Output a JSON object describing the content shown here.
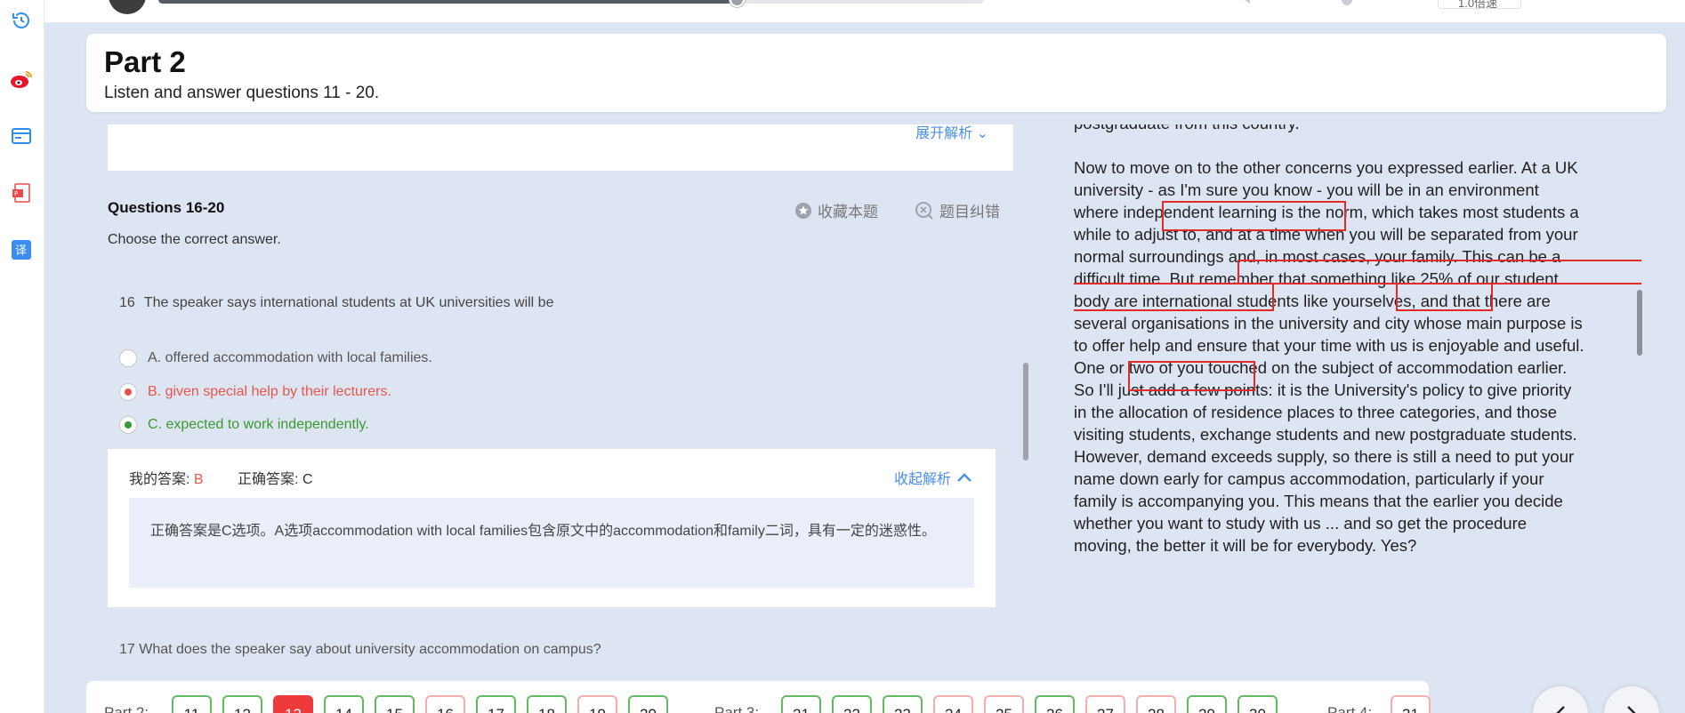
{
  "header": {
    "part_title": "Part 2",
    "instruction": "Listen and answer questions 11 - 20."
  },
  "audio": {
    "progress_fraction": 0.7,
    "speed_label": "1.0倍速"
  },
  "previous_question": {
    "expand_label": "展开解析"
  },
  "question_group": {
    "heading": "Questions 16-20",
    "instruction": "Choose the correct answer.",
    "favorite_label": "收藏本题",
    "report_label": "题目纠错"
  },
  "question": {
    "number": "16",
    "text": "The speaker says international students at UK universities will be",
    "options": [
      {
        "text": "A. offered accommodation with local families.",
        "state": "none",
        "color": "#555555"
      },
      {
        "text": "B. given special help by their lecturers.",
        "state": "wrong",
        "color": "#e8564b"
      },
      {
        "text": "C. expected to work independently.",
        "state": "correct",
        "color": "#3a9a2e"
      }
    ]
  },
  "analysis": {
    "my_answer_label": "我的答案:",
    "my_answer": "B",
    "correct_answer_label": "正确答案:",
    "correct_answer": "C",
    "collapse_label": "收起解析",
    "explanation": "正确答案是C选项。A选项accommodation with local families包含原文中的accommodation和family二词，具有一定的迷惑性。"
  },
  "next_question": {
    "text": "17  What does the speaker say about university accommodation on campus?"
  },
  "transcript": {
    "lines": [
      "postgraduate from this country.",
      "",
      "Now to move on to the other concerns you expressed earlier. At a UK",
      "university - as I'm sure you know - you will be in an environment",
      "where independent learning is the norm, which takes most students a",
      "while to adjust to, and at a time when you will be separated from your",
      "normal surroundings and, in most cases, your family. This can be a",
      "difficult time. But remember that something like 25% of our student",
      "body are international students like yourselves, and that there are",
      "several organisations in the university and city whose main purpose is",
      "to offer help and ensure that your time with us is enjoyable and useful.",
      "One or two of you touched on the subject of accommodation earlier.",
      "So I'll just add a few points: it is the University's policy to give priority",
      "in the allocation of residence places to three categories, and those",
      "visiting students, exchange students and new postgraduate students.",
      "However, demand exceeds supply, so there is still a need to put your",
      "name down early for campus accommodation, particularly if your",
      "family is accompanying you. This means that the earlier you decide",
      "whether you want to study with us ... and so get the procedure",
      "moving, the better it will be for everybody. Yes?"
    ]
  },
  "bottom_nav": {
    "part2_label": "Part 2:",
    "part3_label": "Part 3:",
    "part4_label": "Part 4:",
    "part2": [
      {
        "n": "11",
        "status": "correct"
      },
      {
        "n": "12",
        "status": "correct"
      },
      {
        "n": "13",
        "status": "current"
      },
      {
        "n": "14",
        "status": "correct"
      },
      {
        "n": "15",
        "status": "correct"
      },
      {
        "n": "16",
        "status": "wrong"
      },
      {
        "n": "17",
        "status": "correct"
      },
      {
        "n": "18",
        "status": "correct"
      },
      {
        "n": "19",
        "status": "wrong"
      },
      {
        "n": "20",
        "status": "correct"
      }
    ],
    "part3": [
      {
        "n": "21",
        "status": "correct"
      },
      {
        "n": "22",
        "status": "correct"
      },
      {
        "n": "23",
        "status": "correct"
      },
      {
        "n": "24",
        "status": "wrong"
      },
      {
        "n": "25",
        "status": "wrong"
      },
      {
        "n": "26",
        "status": "correct"
      },
      {
        "n": "27",
        "status": "wrong"
      },
      {
        "n": "28",
        "status": "wrong"
      },
      {
        "n": "29",
        "status": "correct"
      },
      {
        "n": "30",
        "status": "correct"
      }
    ],
    "part4": [
      {
        "n": "31",
        "status": "wrong"
      }
    ]
  },
  "icons": {
    "sidebar": [
      "history-icon",
      "weibo-icon",
      "card-icon",
      "pdf-icon",
      "translate-icon"
    ],
    "accent_color": "#2f8ff0"
  }
}
